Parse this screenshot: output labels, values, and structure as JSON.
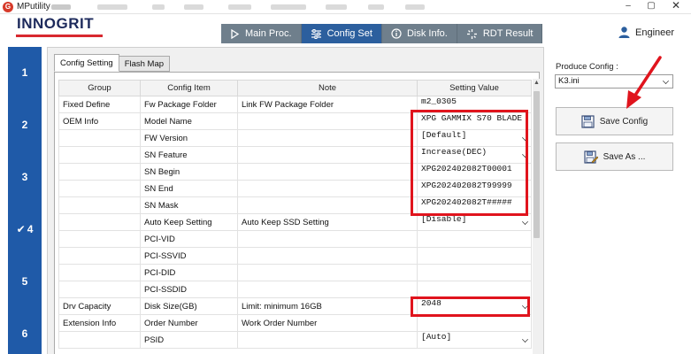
{
  "window": {
    "title": "MPutility",
    "app_icon": "logo-icon"
  },
  "header": {
    "logo": "INNOGRIT",
    "tabs": [
      {
        "label": "Main Proc.",
        "icon": "play-icon",
        "active": false
      },
      {
        "label": "Config Set",
        "icon": "sliders-icon",
        "active": true
      },
      {
        "label": "Disk Info.",
        "icon": "info-icon",
        "active": false
      },
      {
        "label": "RDT Result",
        "icon": "sparkle-icon",
        "active": false
      }
    ],
    "user": {
      "label": "Engineer",
      "icon": "user-icon"
    }
  },
  "steps": [
    {
      "label": "1"
    },
    {
      "label": "2"
    },
    {
      "label": "3"
    },
    {
      "label": "4",
      "done": true
    },
    {
      "label": "5"
    },
    {
      "label": "6"
    }
  ],
  "subtabs": [
    {
      "label": "Config Setting"
    },
    {
      "label": "Flash Map"
    }
  ],
  "table": {
    "headers": [
      "Group",
      "Config Item",
      "Note",
      "Setting Value"
    ],
    "rows": [
      {
        "group": "Fixed Define",
        "item": "Fw Package Folder",
        "note": "Link FW Package Folder",
        "value": "m2_0305",
        "dropdown": false
      },
      {
        "group": "OEM Info",
        "item": "Model Name",
        "note": "",
        "value": "XPG GAMMIX S70 BLADE",
        "dropdown": false
      },
      {
        "group": "",
        "item": "FW Version",
        "note": "",
        "value": "[Default]",
        "dropdown": true
      },
      {
        "group": "",
        "item": "SN Feature",
        "note": "",
        "value": "Increase(DEC)",
        "dropdown": true
      },
      {
        "group": "",
        "item": "SN Begin",
        "note": "",
        "value": "XPG202402082T00001",
        "dropdown": false
      },
      {
        "group": "",
        "item": "SN End",
        "note": "",
        "value": "XPG202402082T99999",
        "dropdown": false
      },
      {
        "group": "",
        "item": "SN Mask",
        "note": "",
        "value": "XPG202402082T#####",
        "dropdown": false
      },
      {
        "group": "",
        "item": "Auto Keep Setting",
        "note": "Auto Keep SSD Setting",
        "value": "[Disable]",
        "dropdown": true
      },
      {
        "group": "",
        "item": "PCI-VID",
        "note": "",
        "value": "",
        "dropdown": false
      },
      {
        "group": "",
        "item": "PCI-SSVID",
        "note": "",
        "value": "",
        "dropdown": false
      },
      {
        "group": "",
        "item": "PCI-DID",
        "note": "",
        "value": "",
        "dropdown": false
      },
      {
        "group": "",
        "item": "PCI-SSDID",
        "note": "",
        "value": "",
        "dropdown": false
      },
      {
        "group": "Drv Capacity",
        "item": "Disk Size(GB)",
        "note": "Limit: minimum 16GB",
        "value": "2048",
        "dropdown": true
      },
      {
        "group": "Extension Info",
        "item": "Order Number",
        "note": "Work Order Number",
        "value": "",
        "dropdown": false
      },
      {
        "group": "",
        "item": "PSID",
        "note": "",
        "value": "[Auto]",
        "dropdown": true
      }
    ]
  },
  "right_pane": {
    "produce_label": "Produce Config :",
    "produce_value": "K3.ini",
    "save_config_label": "Save Config",
    "save_as_label": "Save As ...",
    "save_icon": "floppy-disk-icon",
    "save_as_icon": "floppy-disk-edit-icon"
  },
  "colors": {
    "accent": "#2c5f9e",
    "rail": "#1f5aa8",
    "tab_inactive": "#6f7f8c",
    "highlight": "#e0141d",
    "logo_red": "#d8282f"
  }
}
